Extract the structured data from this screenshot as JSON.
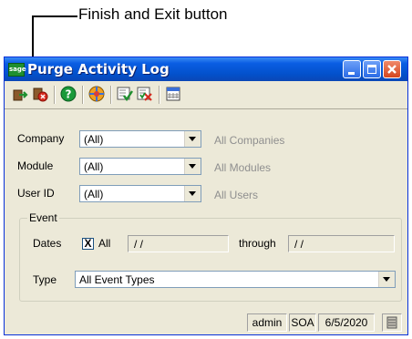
{
  "callout": {
    "text": "Finish and Exit button"
  },
  "window": {
    "title": "Purge Activity Log",
    "logo_text": "sage"
  },
  "toolbar": {
    "buttons": [
      "finish-and-exit-icon",
      "delete-icon",
      "help-icon",
      "globe-icon",
      "check-icon",
      "cancel-check-icon",
      "calendar-icon"
    ]
  },
  "form": {
    "company": {
      "label": "Company",
      "value": "(All)",
      "description": "All Companies"
    },
    "module": {
      "label": "Module",
      "value": "(All)",
      "description": "All Modules"
    },
    "user_id": {
      "label": "User ID",
      "value": "(All)",
      "description": "All Users"
    }
  },
  "event": {
    "group_label": "Event",
    "dates_label": "Dates",
    "all_checkbox_label": "All",
    "all_checked": true,
    "check_mark": "X",
    "from_date": "/ /",
    "through_label": "through",
    "through_date": "/ /",
    "type_label": "Type",
    "type_value": "All Event Types"
  },
  "status": {
    "user": "admin",
    "company": "SOA",
    "date": "6/5/2020"
  },
  "colors": {
    "titlebar": "#0351cc",
    "face": "#ece9d8",
    "close": "#d4461f"
  }
}
